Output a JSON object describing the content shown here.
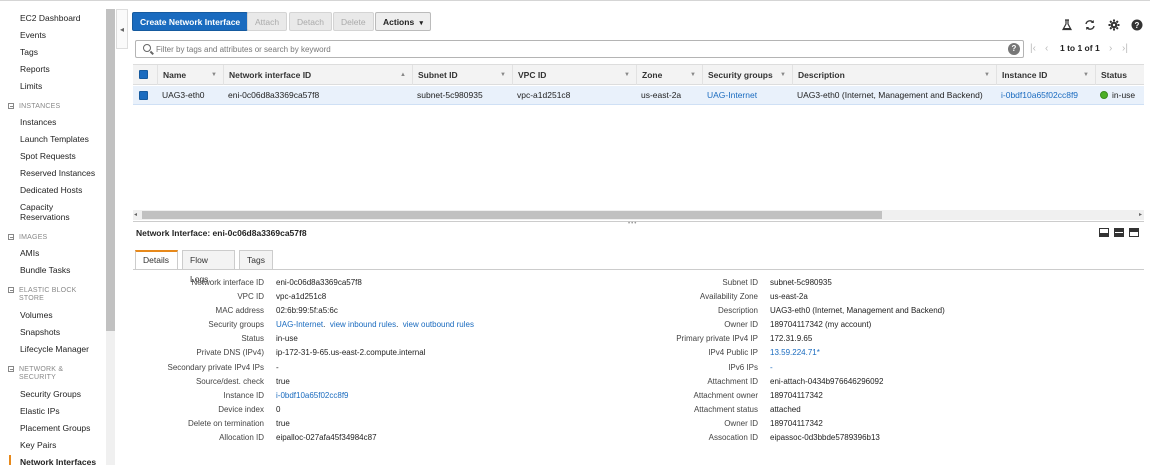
{
  "sidebar": {
    "top_items": [
      "EC2 Dashboard",
      "Events",
      "Tags",
      "Reports",
      "Limits"
    ],
    "sections": [
      {
        "title": "INSTANCES",
        "items": [
          "Instances",
          "Launch Templates",
          "Spot Requests",
          "Reserved Instances",
          "Dedicated Hosts",
          "Capacity Reservations"
        ]
      },
      {
        "title": "IMAGES",
        "items": [
          "AMIs",
          "Bundle Tasks"
        ]
      },
      {
        "title": "ELASTIC BLOCK STORE",
        "items": [
          "Volumes",
          "Snapshots",
          "Lifecycle Manager"
        ]
      },
      {
        "title": "NETWORK & SECURITY",
        "items": [
          "Security Groups",
          "Elastic IPs",
          "Placement Groups",
          "Key Pairs",
          "Network Interfaces"
        ]
      }
    ],
    "collapse_icon": "chevron-left-icon"
  },
  "toolbar": {
    "create": "Create Network Interface",
    "attach": "Attach",
    "detach": "Detach",
    "delete": "Delete",
    "actions": "Actions",
    "actions_icon": "chevron-down-icon",
    "right_icons": [
      "flask-icon",
      "refresh-icon",
      "gear-icon",
      "help-icon"
    ]
  },
  "search": {
    "placeholder": "Filter by tags and attributes or search by keyword",
    "value": "",
    "help_icon": "help-icon"
  },
  "pager": {
    "text": "1 to 1 of 1"
  },
  "table": {
    "columns": [
      "Name",
      "Network interface ID",
      "Subnet ID",
      "VPC ID",
      "Zone",
      "Security groups",
      "Description",
      "Instance ID",
      "Status"
    ],
    "rows": [
      {
        "name": "UAG3-eth0",
        "eni": "eni-0c06d8a3369ca57f8",
        "subnet": "subnet-5c980935",
        "vpc": "vpc-a1d251c8",
        "zone": "us-east-2a",
        "security_groups": "UAG-Internet",
        "description": "UAG3-eth0 (Internet, Management and Backend)",
        "instance": "i-0bdf10a65f02cc8f9",
        "status": "in-use"
      }
    ]
  },
  "detail": {
    "title": "Network Interface: eni-0c06d8a3369ca57f8",
    "tabs": [
      "Details",
      "Flow Logs",
      "Tags"
    ],
    "left": [
      {
        "k": "Network interface ID",
        "v": "eni-0c06d8a3369ca57f8"
      },
      {
        "k": "VPC ID",
        "v": "vpc-a1d251c8"
      },
      {
        "k": "MAC address",
        "v": "02:6b:99:5f:a5:6c"
      },
      {
        "k": "Security groups",
        "v": ""
      },
      {
        "k": "Status",
        "v": "in-use"
      },
      {
        "k": "Private DNS (IPv4)",
        "v": "ip-172-31-9-65.us-east-2.compute.internal"
      },
      {
        "k": "Secondary private IPv4 IPs",
        "v": "-"
      },
      {
        "k": "Source/dest. check",
        "v": "true"
      },
      {
        "k": "Instance ID",
        "v": "i-0bdf10a65f02cc8f9"
      },
      {
        "k": "Device index",
        "v": "0"
      },
      {
        "k": "Delete on termination",
        "v": "true"
      },
      {
        "k": "Allocation ID",
        "v": "eipalloc-027afa45f34984c87"
      }
    ],
    "security_groups_links": {
      "group": "UAG-Internet",
      "sep1": ".",
      "inbound": "view inbound rules",
      "sep2": ".",
      "outbound": "view outbound rules"
    },
    "right": [
      {
        "k": "Subnet ID",
        "v": "subnet-5c980935"
      },
      {
        "k": "Availability Zone",
        "v": "us-east-2a"
      },
      {
        "k": "Description",
        "v": "UAG3-eth0 (Internet, Management and Backend)"
      },
      {
        "k": "Owner ID",
        "v": "189704117342 (my account)"
      },
      {
        "k": "Primary private IPv4 IP",
        "v": "172.31.9.65"
      },
      {
        "k": "IPv4 Public IP",
        "v": "13.59.224.71*"
      },
      {
        "k": "IPv6 IPs",
        "v": "-"
      },
      {
        "k": "Attachment ID",
        "v": "eni-attach-0434b976646296092"
      },
      {
        "k": "Attachment owner",
        "v": "189704117342"
      },
      {
        "k": "Attachment status",
        "v": "attached"
      },
      {
        "k": "Owner ID",
        "v": "189704117342"
      },
      {
        "k": "Assocation ID",
        "v": "eipassoc-0d3bbde5789396b13"
      }
    ]
  },
  "colors": {
    "accent": "#1a6bbf",
    "active_tab": "#e7891b",
    "status_ok": "#4caf27"
  }
}
